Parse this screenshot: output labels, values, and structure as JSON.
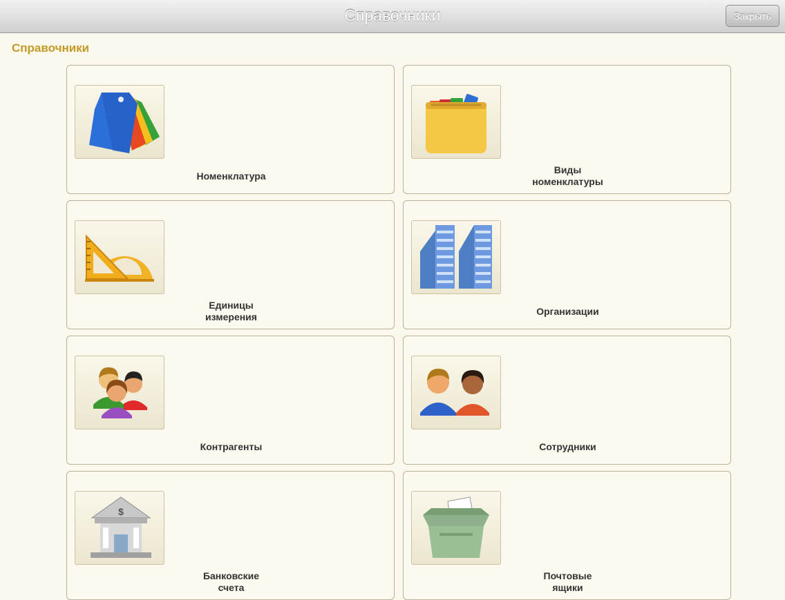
{
  "header": {
    "title": "Справочники",
    "close_label": "Закрыть"
  },
  "section": {
    "title": "Справочники"
  },
  "tiles": [
    {
      "label": "Номенклатура",
      "icon": "tags-icon"
    },
    {
      "label": "Виды\nноменклатуры",
      "icon": "folder-icon"
    },
    {
      "label": "Единицы\nизмерения",
      "icon": "ruler-protractor-icon"
    },
    {
      "label": "Организации",
      "icon": "buildings-icon"
    },
    {
      "label": "Контрагенты",
      "icon": "people-group-icon"
    },
    {
      "label": "Сотрудники",
      "icon": "employees-icon"
    },
    {
      "label": "Банковские\nсчета",
      "icon": "bank-icon"
    },
    {
      "label": "Почтовые\nящики",
      "icon": "mailbox-icon"
    }
  ]
}
